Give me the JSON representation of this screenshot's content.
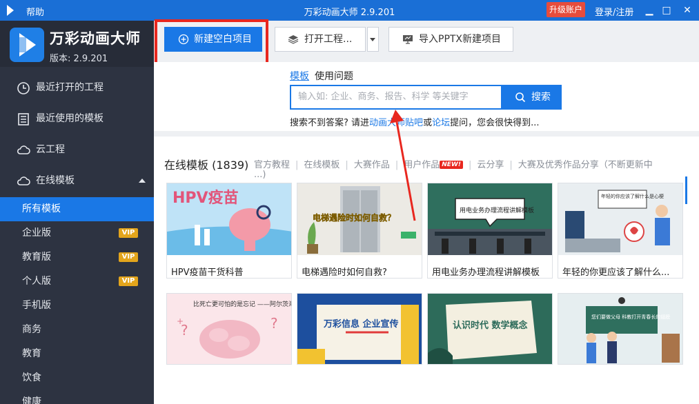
{
  "titlebar": {
    "help": "帮助",
    "title": "万彩动画大师 2.9.201",
    "upgrade": "升级账户",
    "login": "登录/注册",
    "min": "▁",
    "max": "□",
    "close": "✕",
    "bg_color": "#1a6fd6"
  },
  "brand": {
    "name": "万彩动画大师",
    "version": "版本: 2.9.201"
  },
  "sidebar": {
    "items": [
      {
        "label": "最近打开的工程",
        "icon": "clock-icon"
      },
      {
        "label": "最近使用的模板",
        "icon": "template-list-icon"
      },
      {
        "label": "云工程",
        "icon": "cloud-icon"
      },
      {
        "label": "在线模板",
        "icon": "cloud-icon"
      }
    ],
    "sub_items": [
      {
        "label": "所有模板",
        "vip": ""
      },
      {
        "label": "企业版",
        "vip": "VIP"
      },
      {
        "label": "教育版",
        "vip": "VIP"
      },
      {
        "label": "个人版",
        "vip": "VIP"
      },
      {
        "label": "手机版",
        "vip": ""
      },
      {
        "label": "商务",
        "vip": ""
      },
      {
        "label": "教育",
        "vip": ""
      },
      {
        "label": "饮食",
        "vip": ""
      },
      {
        "label": "健康",
        "vip": ""
      }
    ]
  },
  "toolbar": {
    "new_blank": "新建空白项目",
    "open_project": "打开工程...",
    "import_pptx": "导入PPTX新建项目",
    "accent": "#1a78e6",
    "highlight": "#e8271f"
  },
  "search": {
    "tab_template": "模板",
    "tab_faq": "使用问题",
    "placeholder": "输入如: 企业、商务、报告、科学 等关键字",
    "button": "搜索",
    "hint_pre": "搜索不到答案? 请进",
    "hint_link1": "动画大师贴吧",
    "hint_mid": "或",
    "hint_link2": "论坛",
    "hint_post": "提问，您会很快得到..."
  },
  "templates": {
    "heading": "在线模板 (1839)",
    "categories": [
      "官方教程",
      "在线模板",
      "大赛作品",
      "用户作品",
      "云分享",
      "大赛及优秀作品分享（不断更新中"
    ],
    "categories_more": "...)",
    "new_badge": "NEW!",
    "cards": [
      {
        "title": "HPV疫苗干货科普",
        "thumb_text": "HPV疫苗"
      },
      {
        "title": "电梯遇险时如何自救?",
        "thumb_text": "电梯遇险时如何自救？"
      },
      {
        "title": "用电业务办理流程讲解模板",
        "thumb_text": "用电业务办理流程讲解模板"
      },
      {
        "title": "年轻的你更应该了解什么...",
        "thumb_text": "年轻的你应该了解什么是心梗"
      },
      {
        "title": "",
        "thumb_text": "比死亡更可怕的是忘记 ——阿尔茨海默症"
      },
      {
        "title": "",
        "thumb_text": "万彩信息 企业宣传"
      },
      {
        "title": "",
        "thumb_text": "认识时代 数学概念"
      },
      {
        "title": "",
        "thumb_text": "您们要做父母 科教打开青春长的翅膀"
      }
    ]
  }
}
